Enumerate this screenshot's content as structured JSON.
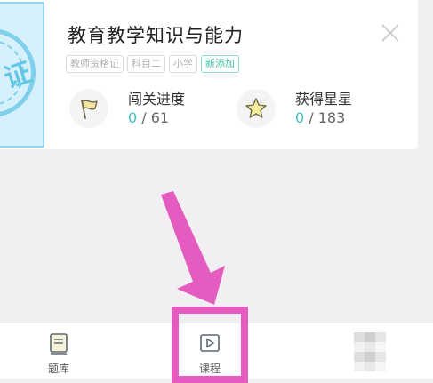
{
  "course": {
    "cover_char": "证",
    "title": "教育教学知识与能力",
    "tags": [
      "教师资格证",
      "科目二",
      "小学"
    ],
    "new_tag": "新添加",
    "progress": {
      "label": "闯关进度",
      "current": "0",
      "separator": " / ",
      "total": "61"
    },
    "stars": {
      "label": "获得星星",
      "current": "0",
      "separator": " / ",
      "total": "183"
    }
  },
  "nav": {
    "question_bank_label": "题库",
    "course_label": "课程"
  },
  "colors": {
    "accent": "#3fbfc9",
    "new_tag": "#3fbfa0",
    "annotation": "#e55cc0",
    "cover": "#d6f1fb"
  },
  "icons": {
    "close": "close-icon",
    "flag": "flag-icon",
    "star": "star-icon",
    "question_bank": "book-icon",
    "course": "play-icon"
  }
}
